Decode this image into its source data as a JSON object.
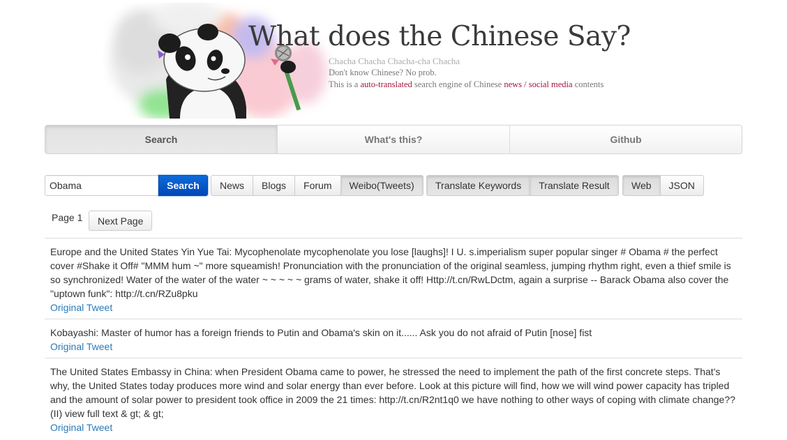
{
  "header": {
    "title": "What does the Chinese Say?",
    "tagline": "Chacha Chacha Chacha-cha Chacha",
    "line1": "Don't know Chinese? No prob.",
    "line2_prefix": "This is a ",
    "line2_link1": "auto-translated",
    "line2_middle": " search engine of Chinese ",
    "line2_link2": "news / social media",
    "line2_suffix": " contents",
    "accent_color": "#a3163a"
  },
  "nav": {
    "items": [
      {
        "label": "Search",
        "active": true
      },
      {
        "label": "What's this?",
        "active": false
      },
      {
        "label": "Github",
        "active": false
      }
    ]
  },
  "search": {
    "value": "Obama",
    "placeholder": "",
    "button_label": "Search",
    "button_color": "#0a5bd0"
  },
  "sources": [
    {
      "label": "News",
      "active": false
    },
    {
      "label": "Blogs",
      "active": false
    },
    {
      "label": "Forum",
      "active": false
    },
    {
      "label": "Weibo(Tweets)",
      "active": true
    }
  ],
  "translate": [
    {
      "label": "Translate Keywords",
      "active": true
    },
    {
      "label": "Translate Result",
      "active": true
    }
  ],
  "format": [
    {
      "label": "Web",
      "active": true
    },
    {
      "label": "JSON",
      "active": false
    }
  ],
  "pager": {
    "page_label": "Page 1",
    "next_label": "Next Page"
  },
  "results": [
    {
      "text": "Europe and the United States Yin Yue Tai: Mycophenolate mycophenolate you lose [laughs]! I U. s.imperialism super popular singer # Obama # the perfect cover #Shake it Off# \"MMM hum ~\" more squeamish! Pronunciation with the pronunciation of the original seamless, jumping rhythm right, even a thief smile is so synchronized! Water of the water of the water ~ ~ ~ ~ ~ grams of water, shake it off! Http://t.cn/RwLDctm, again a surprise -- Barack Obama also cover the \"uptown funk\": http://t.cn/RZu8pku",
      "link": "Original Tweet"
    },
    {
      "text": "Kobayashi: Master of humor has a foreign friends to Putin and Obama's skin on it...... Ask you do not afraid of Putin [nose] fist",
      "link": "Original Tweet"
    },
    {
      "text": "The United States Embassy in China: when President Obama came to power, he stressed the need to implement the path of the first concrete steps. That's why, the United States today produces more wind and solar energy than ever before. Look at this picture will find, how we will wind power capacity has tripled and the amount of solar power to president took office in 2009 the 21 times: http://t.cn/R2nt1q0 we have nothing to other ways of coping with climate change?? (II) view full text & gt; & gt;",
      "link": "Original Tweet"
    }
  ],
  "link_color": "#2a7ab8"
}
